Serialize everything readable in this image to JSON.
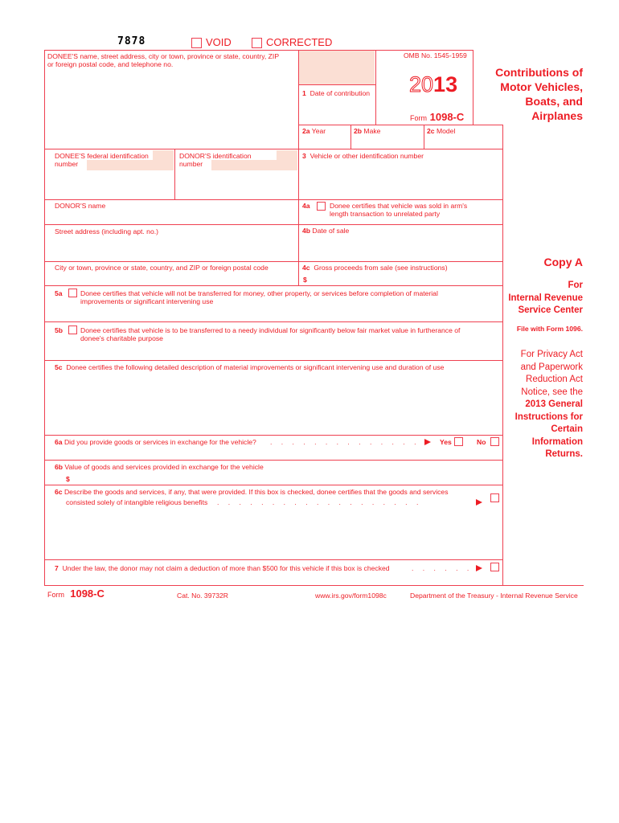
{
  "header": {
    "form_code": "7878",
    "void_label": "VOID",
    "corrected_label": "CORRECTED"
  },
  "donee_box": {
    "label_line1": "DONEE'S name, street address, city or town, province or state, country, ZIP",
    "label_line2": "or foreign postal code, and telephone no."
  },
  "box1": {
    "num": "1",
    "label": "Date of contribution"
  },
  "omb": {
    "omb_number": "OMB No. 1545-1959",
    "year_outline": "20",
    "year_bold": "13",
    "form_prefix": "Form",
    "form_name": "1098-C"
  },
  "title": {
    "line1": "Contributions of",
    "line2": "Motor Vehicles,",
    "line3": "Boats, and",
    "line4": "Airplanes"
  },
  "box2": {
    "a_num": "2a",
    "a_label": "Year",
    "b_num": "2b",
    "b_label": "Make",
    "c_num": "2c",
    "c_label": "Model"
  },
  "ids": {
    "donee_fid_line1": "DONEE'S federal identification",
    "donee_fid_line2": "number",
    "donor_id_line1": "DONOR'S identification",
    "donor_id_line2": "number"
  },
  "box3": {
    "num": "3",
    "label": "Vehicle or other identification number"
  },
  "donor": {
    "name_label": "DONOR'S name",
    "street_label": "Street address (including apt. no.)",
    "city_label": "City or town, province or state, country, and ZIP or foreign postal code"
  },
  "box4a": {
    "num": "4a",
    "line1": "Donee certifies that vehicle was sold in arm's",
    "line2": "length transaction to unrelated party"
  },
  "box4b": {
    "num": "4b",
    "label": "Date of sale"
  },
  "box4c": {
    "num": "4c",
    "label": "Gross proceeds from sale (see instructions)",
    "currency": "$"
  },
  "box5a": {
    "num": "5a",
    "line1": "Donee certifies that vehicle will not be transferred for money, other property, or services before completion of material",
    "line2": "improvements or significant intervening use"
  },
  "box5b": {
    "num": "5b",
    "line1": "Donee certifies that vehicle is to be transferred to a needy individual for significantly below fair market value in furtherance of",
    "line2": "donee's charitable purpose"
  },
  "box5c": {
    "num": "5c",
    "label": "Donee certifies the following detailed description of material improvements or significant intervening use and duration of use"
  },
  "box6a": {
    "num": "6a",
    "label": "Did you provide goods or services in exchange for the vehicle?",
    "dots": ". . . . . . . . . . . . . . .",
    "yes_label": "Yes",
    "no_label": "No"
  },
  "box6b": {
    "num": "6b",
    "label": "Value of goods and services provided in exchange for the vehicle",
    "currency": "$"
  },
  "box6c": {
    "num": "6c",
    "line1": "Describe the goods and services, if any, that were provided. If this box is checked, donee certifies that the goods and services",
    "line2": "consisted solely of intangible religious benefits",
    "dots": ". . . . . . . . . . . . . . . . . . ."
  },
  "box7": {
    "num": "7",
    "label": "Under the law, the donor may not claim a deduction of more than $500 for this vehicle if this box is checked",
    "dots": ". . . . . ."
  },
  "sidebar": {
    "copy": "Copy A",
    "for_line1": "For",
    "for_line2": "Internal Revenue",
    "for_line3": "Service Center",
    "file_with": "File with Form 1096.",
    "privacy_line1": "For Privacy Act",
    "privacy_line2": "and Paperwork",
    "privacy_line3": "Reduction Act",
    "privacy_line4": "Notice, see the",
    "privacy_line5": "2013 General",
    "privacy_line6": "Instructions for",
    "privacy_line7": "Certain",
    "privacy_line8": "Information",
    "privacy_line9": "Returns."
  },
  "footer": {
    "form_prefix": "Form",
    "form_name": "1098-C",
    "cat_no": "Cat. No. 39732R",
    "url": "www.irs.gov/form1098c",
    "department": "Department of the Treasury - Internal Revenue Service"
  },
  "colors": {
    "ink": "#ed1c24",
    "rule": "#ef4050",
    "shade": "#fbdfd4"
  }
}
